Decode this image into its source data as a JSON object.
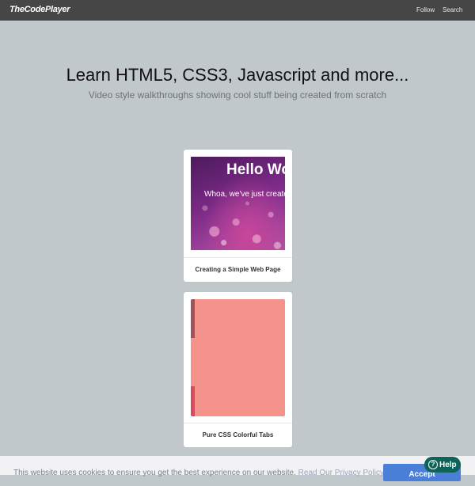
{
  "header": {
    "logo": "TheCodePlayer",
    "nav": [
      {
        "label": "Follow"
      },
      {
        "label": "Search"
      }
    ]
  },
  "hero": {
    "title": "Learn HTML5, CSS3, Javascript and more...",
    "subtitle": "Video style walkthroughs showing cool stuff being created from scratch"
  },
  "cards": [
    {
      "title": "Creating a Simple Web Page",
      "preview_heading": "Hello World",
      "preview_text": "Whoa, we've just created our first web page"
    },
    {
      "title": "Pure CSS Colorful Tabs"
    }
  ],
  "cookie": {
    "text": "This website uses cookies to ensure you get the best experience on our website.",
    "link": "Read Our Privacy Policy",
    "accept": "Accept"
  },
  "help": {
    "icon": "question-circle-icon",
    "label": "Help"
  },
  "colors": {
    "background": "#c1c8cb",
    "topbar": "#464646",
    "accept": "#4a7fd8",
    "help": "#0f6257",
    "tabs_panel": "#f4928c"
  }
}
